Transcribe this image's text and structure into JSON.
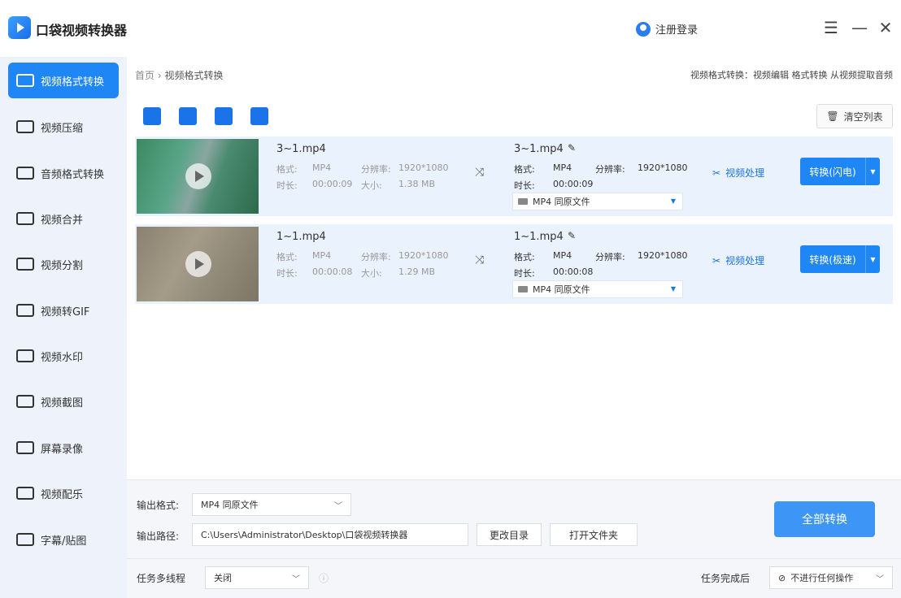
{
  "app": {
    "title": "口袋视频转换器",
    "login": "注册登录"
  },
  "window": {
    "menu": "☰",
    "minimize": "—",
    "close": "✕"
  },
  "sidebar": {
    "items": [
      {
        "label": "视频格式转换",
        "active": true
      },
      {
        "label": "视频压缩"
      },
      {
        "label": "音频格式转换"
      },
      {
        "label": "视频合并"
      },
      {
        "label": "视频分割"
      },
      {
        "label": "视频转GIF"
      },
      {
        "label": "视频水印"
      },
      {
        "label": "视频截图"
      },
      {
        "label": "屏幕录像"
      },
      {
        "label": "视频配乐"
      },
      {
        "label": "字幕/贴图"
      }
    ]
  },
  "breadcrumb": {
    "home": "首页",
    "sep": "›",
    "current": "视频格式转换"
  },
  "top_links": "视频格式转换：视频编辑 格式转换 从视频提取音频",
  "toolbar": {
    "clear": "清空列表"
  },
  "files": [
    {
      "name": "3~1.mp4",
      "format_label": "格式:",
      "format": "MP4",
      "res_label": "分辨率:",
      "res": "1920*1080",
      "dur_label": "时长:",
      "dur": "00:00:09",
      "size_label": "大小:",
      "size": "1.38 MB",
      "out_name": "3~1.mp4",
      "out_format": "MP4",
      "out_res": "1920*1080",
      "out_dur": "00:00:09",
      "out_select": "MP4 同原文件",
      "edit": "视频处理",
      "convert": "转换(闪电)"
    },
    {
      "name": "1~1.mp4",
      "format_label": "格式:",
      "format": "MP4",
      "res_label": "分辨率:",
      "res": "1920*1080",
      "dur_label": "时长:",
      "dur": "00:00:08",
      "size_label": "大小:",
      "size": "1.29 MB",
      "out_name": "1~1.mp4",
      "out_format": "MP4",
      "out_res": "1920*1080",
      "out_dur": "00:00:08",
      "out_select": "MP4 同原文件",
      "edit": "视频处理",
      "convert": "转换(极速)"
    }
  ],
  "bottom": {
    "out_format_label": "输出格式:",
    "out_format_value": "MP4 同原文件",
    "out_path_label": "输出路径:",
    "out_path_value": "C:\\Users\\Administrator\\Desktop\\口袋视频转换器",
    "change_dir": "更改目录",
    "open_folder": "打开文件夹",
    "convert_all": "全部转换",
    "multithread_label": "任务多线程",
    "multithread_value": "关闭",
    "after_label": "任务完成后",
    "after_value": "不进行任何操作"
  }
}
